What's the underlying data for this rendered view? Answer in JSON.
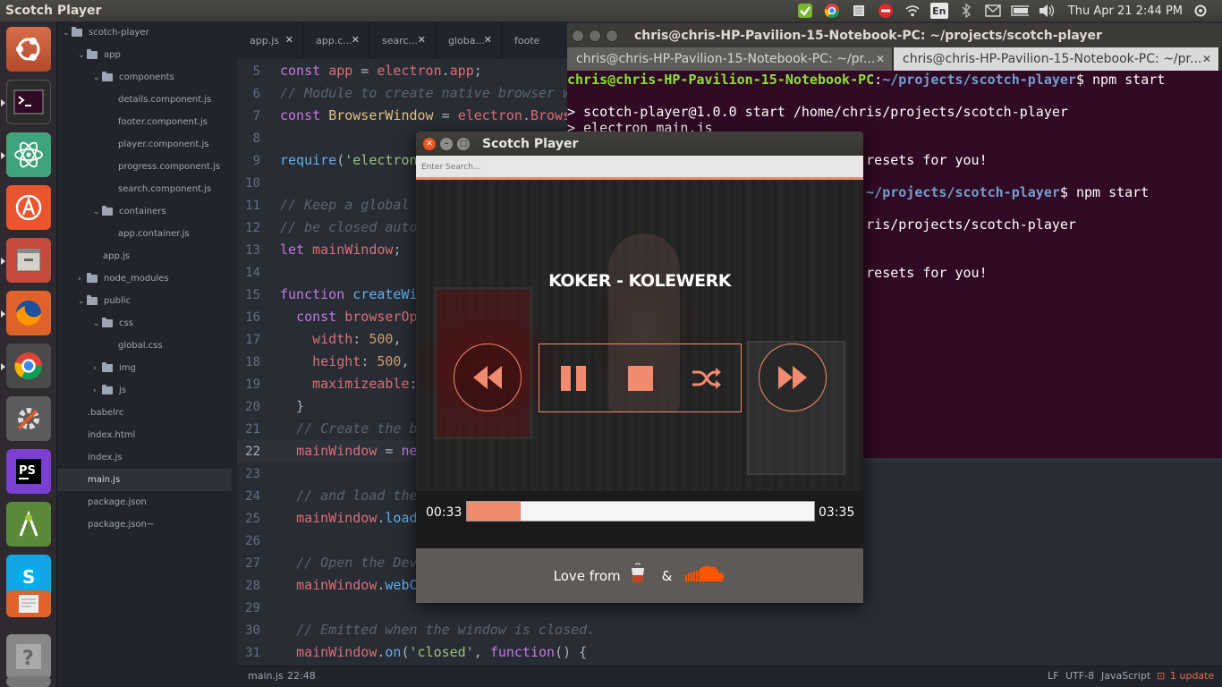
{
  "top_panel": {
    "app_title": "Scotch Player",
    "clock": "Thu Apr 21  2:44 PM",
    "lang": "En"
  },
  "tree": [
    {
      "label": "scotch-player",
      "depth": 0,
      "type": "folder",
      "open": true
    },
    {
      "label": "app",
      "depth": 1,
      "type": "folder",
      "open": true
    },
    {
      "label": "components",
      "depth": 2,
      "type": "folder",
      "open": true
    },
    {
      "label": "details.component.js",
      "depth": 3,
      "type": "file"
    },
    {
      "label": "footer.component.js",
      "depth": 3,
      "type": "file"
    },
    {
      "label": "player.component.js",
      "depth": 3,
      "type": "file"
    },
    {
      "label": "progress.component.js",
      "depth": 3,
      "type": "file"
    },
    {
      "label": "search.component.js",
      "depth": 3,
      "type": "file"
    },
    {
      "label": "containers",
      "depth": 2,
      "type": "folder",
      "open": true
    },
    {
      "label": "app.container.js",
      "depth": 3,
      "type": "file"
    },
    {
      "label": "app.js",
      "depth": 2,
      "type": "file"
    },
    {
      "label": "node_modules",
      "depth": 1,
      "type": "folder",
      "open": false
    },
    {
      "label": "public",
      "depth": 1,
      "type": "folder",
      "open": true
    },
    {
      "label": "css",
      "depth": 2,
      "type": "folder",
      "open": true
    },
    {
      "label": "global.css",
      "depth": 3,
      "type": "file"
    },
    {
      "label": "img",
      "depth": 2,
      "type": "folder",
      "open": false
    },
    {
      "label": "js",
      "depth": 2,
      "type": "folder",
      "open": false
    },
    {
      "label": ".babelrc",
      "depth": 1,
      "type": "file"
    },
    {
      "label": "index.html",
      "depth": 1,
      "type": "file"
    },
    {
      "label": "index.js",
      "depth": 1,
      "type": "file"
    },
    {
      "label": "main.js",
      "depth": 1,
      "type": "file",
      "selected": true
    },
    {
      "label": "package.json",
      "depth": 1,
      "type": "file"
    },
    {
      "label": "package.json~",
      "depth": 1,
      "type": "file"
    }
  ],
  "editor_tabs": [
    "app.js",
    "app.c...",
    "searc...",
    "globa...",
    "foote"
  ],
  "code_lines": [
    {
      "n": "5",
      "html": "<span class='kw'>const</span> <span class='pr'>app</span> = <span class='pr'>electron</span>.<span class='pr'>app</span>;"
    },
    {
      "n": "6",
      "html": "<span class='cm'>// Module to create native browser window.</span>"
    },
    {
      "n": "7",
      "html": "<span class='kw'>const</span> <span class='ty'>BrowserWindow</span> = <span class='pr'>electron</span>.<span class='pr'>BrowserWindow</span>;"
    },
    {
      "n": "8",
      "html": ""
    },
    {
      "n": "9",
      "html": "<span class='fn'>require</span>(<span class='str'>'electron</span>"
    },
    {
      "n": "10",
      "html": ""
    },
    {
      "n": "11",
      "html": "<span class='cm'>// Keep a global</span>"
    },
    {
      "n": "12",
      "html": "<span class='cm'>// be closed auto</span>"
    },
    {
      "n": "13",
      "html": "<span class='kw'>let</span> <span class='pr'>mainWindow</span>;"
    },
    {
      "n": "14",
      "html": ""
    },
    {
      "n": "15",
      "html": "<span class='kw'>function</span> <span class='fn'>createWi</span>"
    },
    {
      "n": "16",
      "html": "  <span class='kw'>const</span> <span class='pr'>browserOp</span>"
    },
    {
      "n": "17",
      "html": "    <span class='pr'>width</span>: <span class='num'>500</span>,"
    },
    {
      "n": "18",
      "html": "    <span class='pr'>height</span>: <span class='num'>500</span>,"
    },
    {
      "n": "19",
      "html": "    <span class='pr'>maximizeable</span>:"
    },
    {
      "n": "20",
      "html": "  }"
    },
    {
      "n": "21",
      "html": "  <span class='cm'>// Create the b</span>"
    },
    {
      "n": "22",
      "html": "  <span class='pr'>mainWindow</span> = <span class='kw'>ne</span>",
      "current": true
    },
    {
      "n": "23",
      "html": ""
    },
    {
      "n": "24",
      "html": "  <span class='cm'>// and load the</span>"
    },
    {
      "n": "25",
      "html": "  <span class='pr'>mainWindow</span>.<span class='fn'>load</span>"
    },
    {
      "n": "26",
      "html": ""
    },
    {
      "n": "27",
      "html": "  <span class='cm'>// Open the Dev</span>"
    },
    {
      "n": "28",
      "html": "  <span class='pr'>mainWindow</span>.<span class='fn'>webC</span>"
    },
    {
      "n": "29",
      "html": ""
    },
    {
      "n": "30",
      "html": "  <span class='cm'>// Emitted when the window is closed.</span>"
    },
    {
      "n": "31",
      "html": "  <span class='pr'>mainWindow</span>.<span class='fn'>on</span>(<span class='str'>'closed'</span>, <span class='kw'>function</span>() {"
    }
  ],
  "status_bar": {
    "file": "main.js",
    "position": "22:48",
    "line_ending": "LF",
    "encoding": "UTF-8",
    "grammar": "JavaScript",
    "updates": "1 update"
  },
  "terminal": {
    "title": "chris@chris-HP-Pavilion-15-Notebook-PC: ~/projects/scotch-player",
    "tabs": [
      "chris@chris-HP-Pavilion-15-Notebook-PC: ~/pr...",
      "chris@chris-HP-Pavilion-15-Notebook-PC: ~/pr..."
    ],
    "lines": [
      {
        "html": "<span class='pg'>chris@chris-HP-Pavilion-15-Notebook-PC</span>:<span class='pb'>~/projects/scotch-player</span>$ npm start"
      },
      {
        "html": ""
      },
      {
        "html": "&gt; scotch-player@1.0.0 start /home/chris/projects/scotch-player"
      },
      {
        "html": "&gt; electron main.js"
      },
      {
        "html": ""
      },
      {
        "html": "                                     resets for you!"
      },
      {
        "html": ""
      },
      {
        "html": "                                  <span class='pg'>PC</span>:<span class='pb'>~/projects/scotch-player</span>$ npm start"
      },
      {
        "html": ""
      },
      {
        "html": "                                     ris/projects/scotch-player"
      },
      {
        "html": ""
      },
      {
        "html": ""
      },
      {
        "html": "                                     resets for you!"
      },
      {
        "html": ""
      },
      {
        "html": ""
      },
      {
        "html": ""
      }
    ]
  },
  "player": {
    "window_title": "Scotch Player",
    "search_placeholder": "Enter Search...",
    "song_title": "KOKER - KOLEWERK",
    "elapsed": "00:33",
    "duration": "03:35",
    "progress": 0.154,
    "footer_text": "Love from",
    "footer_amp": "&",
    "accent_color": "#f08b6f"
  }
}
